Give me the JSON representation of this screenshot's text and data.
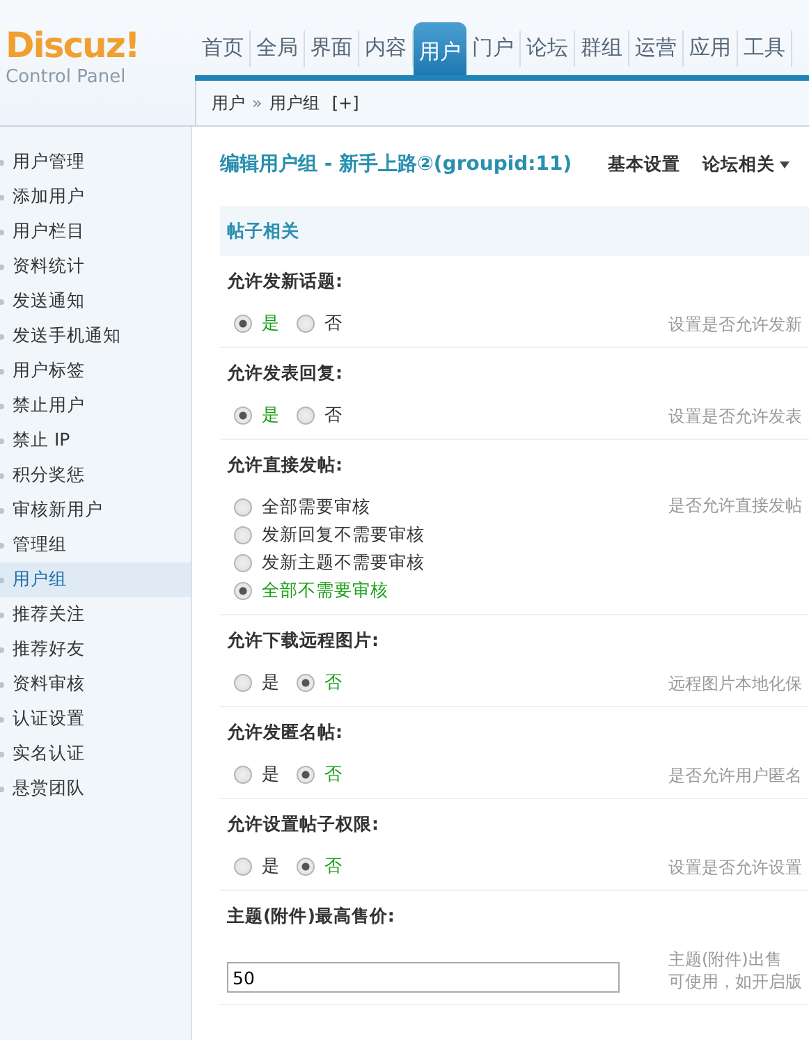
{
  "logo": {
    "name": "Discuz!",
    "subtitle": "Control Panel"
  },
  "nav": [
    {
      "label": "首页",
      "selected": false
    },
    {
      "label": "全局",
      "selected": false
    },
    {
      "label": "界面",
      "selected": false
    },
    {
      "label": "内容",
      "selected": false
    },
    {
      "label": "用户",
      "selected": true
    },
    {
      "label": "门户",
      "selected": false
    },
    {
      "label": "论坛",
      "selected": false
    },
    {
      "label": "群组",
      "selected": false
    },
    {
      "label": "运营",
      "selected": false
    },
    {
      "label": "应用",
      "selected": false
    },
    {
      "label": "工具",
      "selected": false
    }
  ],
  "breadcrumb": {
    "items": [
      "用户",
      "用户组"
    ],
    "separator": "»",
    "add": "[+]"
  },
  "sidebar": {
    "items": [
      {
        "label": "用户管理",
        "selected": false
      },
      {
        "label": "添加用户",
        "selected": false
      },
      {
        "label": "用户栏目",
        "selected": false
      },
      {
        "label": "资料统计",
        "selected": false
      },
      {
        "label": "发送通知",
        "selected": false
      },
      {
        "label": "发送手机通知",
        "selected": false
      },
      {
        "label": "用户标签",
        "selected": false
      },
      {
        "label": "禁止用户",
        "selected": false
      },
      {
        "label": "禁止 IP",
        "selected": false
      },
      {
        "label": "积分奖惩",
        "selected": false
      },
      {
        "label": "审核新用户",
        "selected": false
      },
      {
        "label": "管理组",
        "selected": false
      },
      {
        "label": "用户组",
        "selected": true
      },
      {
        "label": "推荐关注",
        "selected": false
      },
      {
        "label": "推荐好友",
        "selected": false
      },
      {
        "label": "资料审核",
        "selected": false
      },
      {
        "label": "认证设置",
        "selected": false
      },
      {
        "label": "实名认证",
        "selected": false
      },
      {
        "label": "悬赏团队",
        "selected": false
      }
    ]
  },
  "page_title": "编辑用户组 - 新手上路②(groupid:11)",
  "page_tabs": [
    {
      "label": "基本设置",
      "dropdown": false
    },
    {
      "label": "论坛相关",
      "dropdown": true
    }
  ],
  "section_title": "帖子相关",
  "settings": [
    {
      "kind": "inline",
      "label": "允许发新话题:",
      "hint": "设置是否允许发新",
      "options": [
        {
          "label": "是",
          "selected": true
        },
        {
          "label": "否",
          "selected": false
        }
      ]
    },
    {
      "kind": "inline",
      "label": "允许发表回复:",
      "hint": "设置是否允许发表",
      "options": [
        {
          "label": "是",
          "selected": true
        },
        {
          "label": "否",
          "selected": false
        }
      ]
    },
    {
      "kind": "stacked",
      "label": "允许直接发帖:",
      "hint": "是否允许直接发帖",
      "options": [
        {
          "label": "全部需要审核",
          "selected": false
        },
        {
          "label": "发新回复不需要审核",
          "selected": false
        },
        {
          "label": "发新主题不需要审核",
          "selected": false
        },
        {
          "label": "全部不需要审核",
          "selected": true
        }
      ]
    },
    {
      "kind": "inline",
      "label": "允许下载远程图片:",
      "hint": "远程图片本地化保",
      "options": [
        {
          "label": "是",
          "selected": false
        },
        {
          "label": "否",
          "selected": true
        }
      ]
    },
    {
      "kind": "inline",
      "label": "允许发匿名帖:",
      "hint": "是否允许用户匿名",
      "options": [
        {
          "label": "是",
          "selected": false
        },
        {
          "label": "否",
          "selected": true
        }
      ]
    },
    {
      "kind": "inline",
      "label": "允许设置帖子权限:",
      "hint": "设置是否允许设置",
      "options": [
        {
          "label": "是",
          "selected": false
        },
        {
          "label": "否",
          "selected": true
        }
      ]
    },
    {
      "kind": "input",
      "label": "主题(附件)最高售价:",
      "hint": "主题(附件)出售",
      "hint_2": "可使用，如开启版",
      "value": "50"
    }
  ]
}
